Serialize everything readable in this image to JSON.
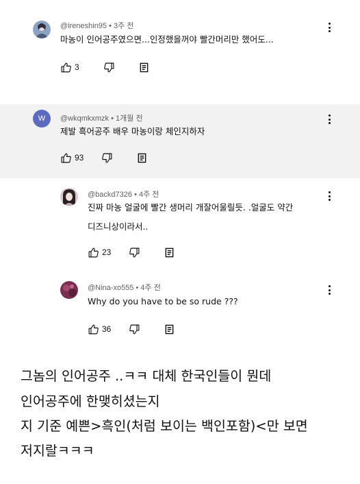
{
  "comments": [
    {
      "handle": "@ireneshin95",
      "time": "3주 전",
      "text_lines": [
        "마농이 인어공주였으면...인정했을꺼야 빨간머리만 했어도..."
      ],
      "likes": "3"
    },
    {
      "handle": "@wkqmkxmzk",
      "time": "1개월 전",
      "avatar_letter": "W",
      "text_lines": [
        "제발 흑어공주 배우 마농이랑 체인지하자"
      ],
      "likes": "93"
    },
    {
      "handle": "@backd7326",
      "time": "4주 전",
      "text_lines": [
        "진짜 마농 얼굴에 빨간 생머리 개잘어울릴듯. .얼굴도 약간",
        "디즈니상이라서.."
      ],
      "likes": "23"
    },
    {
      "handle": "@Nina-xo555",
      "time": "4주 전",
      "text_lines": [
        "Why do you have to be so rude ???"
      ],
      "likes": "36"
    }
  ],
  "separator": "•",
  "post_text": [
    "그놈의 인어공주 ..ㅋㅋ 대체 한국인들이 뭔데",
    "인어공주에 한맺히셨는지",
    "지 기준 예쁜>흑인(처럼 보이는 백인포함)<만 보면",
    "저지랄ㅋㅋㅋ"
  ],
  "colors": {
    "highlight_bg": "#f2f2f2",
    "meta_text": "#606060",
    "avatar_w_bg": "#5c6bc0"
  }
}
